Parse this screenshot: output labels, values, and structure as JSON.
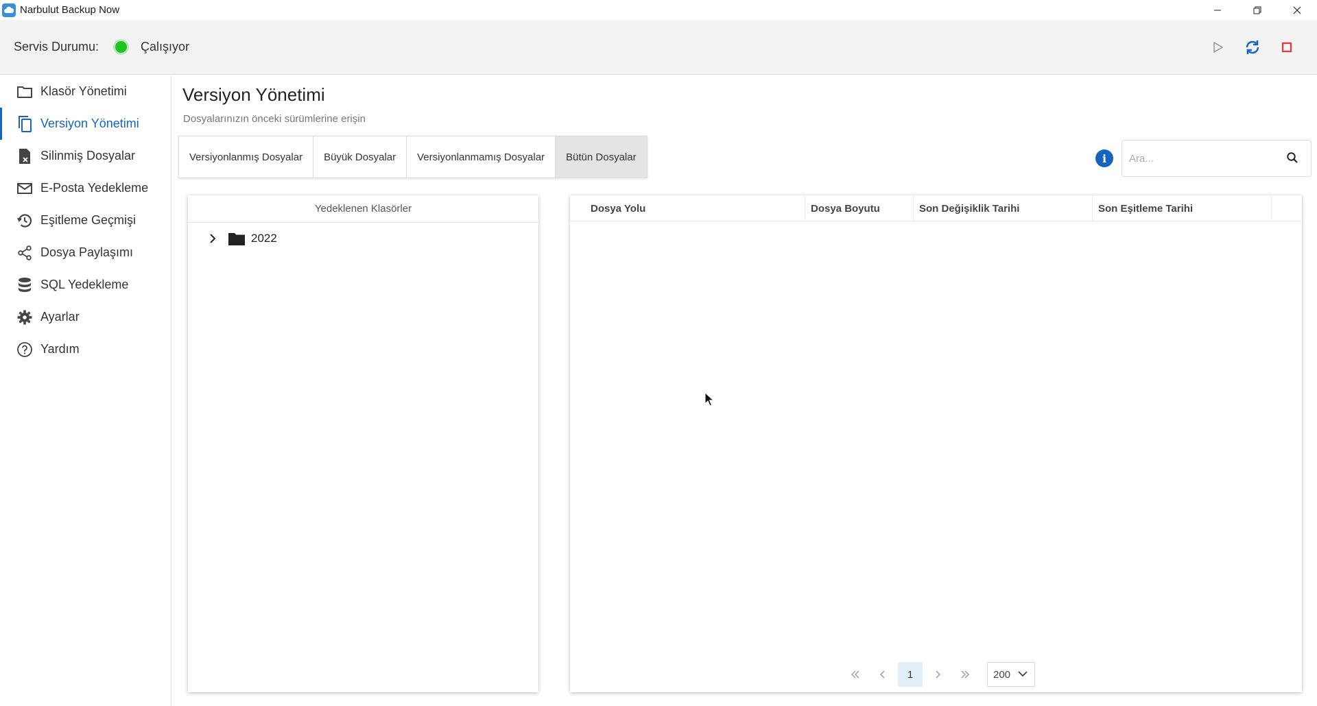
{
  "window": {
    "title": "Narbulut Backup Now",
    "controls": [
      "minimize",
      "restore",
      "close"
    ]
  },
  "service": {
    "label": "Servis Durumu:",
    "status": "Çalışıyor",
    "status_color": "#1fc21f",
    "actions": [
      {
        "name": "play",
        "icon": "play-icon"
      },
      {
        "name": "refresh",
        "icon": "sync-icon"
      },
      {
        "name": "stop",
        "icon": "stop-icon"
      }
    ]
  },
  "sidebar": {
    "accent": "#1565c0",
    "items": [
      {
        "label": "Klasör Yönetimi",
        "icon": "folder-icon",
        "active": false
      },
      {
        "label": "Versiyon Yönetimi",
        "icon": "copy-icon",
        "active": true
      },
      {
        "label": "Silinmiş Dosyalar",
        "icon": "deleted-file-icon",
        "active": false
      },
      {
        "label": "E-Posta Yedekleme",
        "icon": "mail-icon",
        "active": false
      },
      {
        "label": "Eşitleme Geçmişi",
        "icon": "history-icon",
        "active": false
      },
      {
        "label": "Dosya Paylaşımı",
        "icon": "share-icon",
        "active": false
      },
      {
        "label": "SQL Yedekleme",
        "icon": "database-icon",
        "active": false
      },
      {
        "label": "Ayarlar",
        "icon": "gear-icon",
        "active": false
      },
      {
        "label": "Yardım",
        "icon": "help-icon",
        "active": false
      }
    ]
  },
  "main": {
    "title": "Versiyon Yönetimi",
    "subtitle": "Dosyalarınızın önceki sürümlerine erişin",
    "tabs": [
      {
        "label": "Versiyonlanmış Dosyalar",
        "active": false
      },
      {
        "label": "Büyük Dosyalar",
        "active": false
      },
      {
        "label": "Versiyonlanmamış Dosyalar",
        "active": false
      },
      {
        "label": "Bütün Dosyalar",
        "active": true
      }
    ],
    "search": {
      "placeholder": "Ara..."
    }
  },
  "folders": {
    "header": "Yedeklenen Klasörler",
    "items": [
      {
        "label": "2022",
        "expanded": false
      }
    ]
  },
  "table": {
    "columns": [
      "Dosya Yolu",
      "Dosya Boyutu",
      "Son Değişiklik Tarihi",
      "Son Eşitleme Tarihi"
    ],
    "rows": []
  },
  "pager": {
    "current_page": "1",
    "page_size": "200"
  }
}
